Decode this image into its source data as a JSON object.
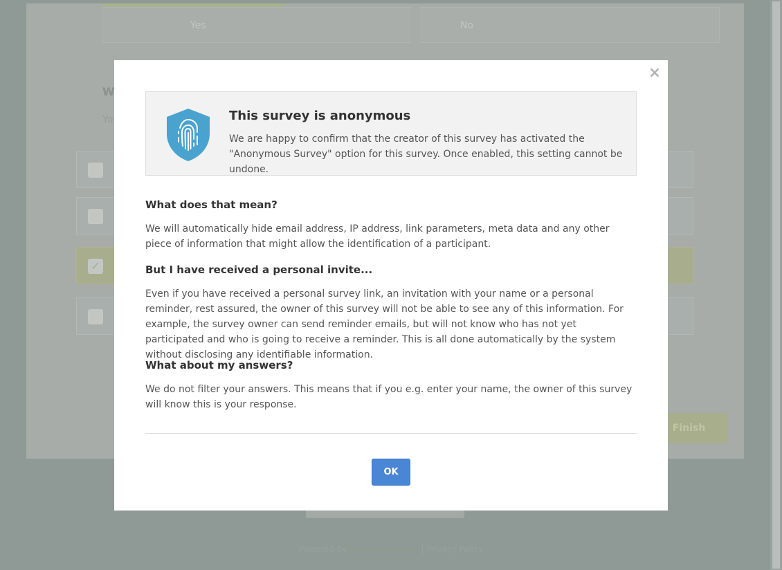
{
  "background": {
    "option_yes": "Yes",
    "option_no": "No",
    "question_title": "What d",
    "question_hint": "You can",
    "finish_label": "Finish",
    "footer_powered": "Powered by",
    "footer_brand": "SurveyHero.com",
    "footer_separator": "|",
    "footer_privacy": "Privacy Policy"
  },
  "modal": {
    "close_glyph": "×",
    "notice": {
      "title": "This survey is anonymous",
      "text": "We are happy to confirm that the creator of this survey has activated the \"Anonymous Survey\" option for this survey. Once enabled, this setting cannot be undone.",
      "icon": "shield-fingerprint-icon",
      "icon_color": "#4aa3cf"
    },
    "sections": [
      {
        "heading": "What does that mean?",
        "body": "We will automatically hide email address, IP address, link parameters, meta data and any other piece of information that might allow the identification of a participant."
      },
      {
        "heading": "But I have received a personal invite...",
        "body": "Even if you have received a personal survey link, an invitation with your name or a personal reminder, rest assured, the owner of this survey will not be able to see any of this information. For example, the survey owner can send reminder emails, but will not know who has not yet participated and who is going to receive a reminder. This is all done automatically by the system without disclosing any identifiable information."
      },
      {
        "heading": "What about my answers?",
        "body": "We do not filter your answers. This means that if you e.g. enter your name, the owner of this survey will know this is your response."
      }
    ],
    "ok_label": "OK",
    "ok_color": "#4a86d6"
  }
}
